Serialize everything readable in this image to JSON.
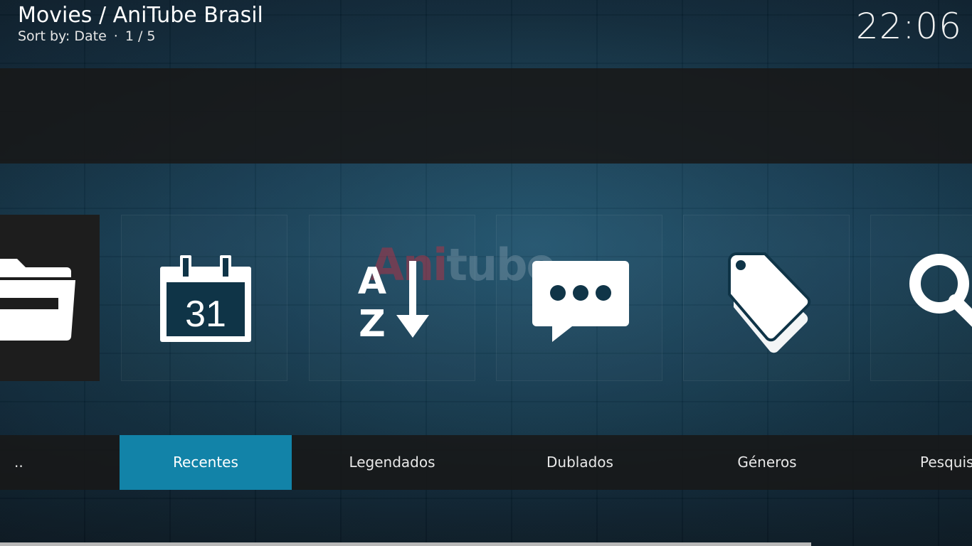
{
  "header": {
    "title": "Movies / AniTube Brasil",
    "sort_label": "Sort by: Date",
    "separator": "·",
    "page_counter": "1 / 5",
    "clock": "22:06"
  },
  "watermark": {
    "brand_part1": "Ani",
    "brand_part2": "tube"
  },
  "items": [
    {
      "label": "..",
      "icon": "folder-back-icon"
    },
    {
      "label": "Recentes",
      "icon": "calendar-icon",
      "calendar_day": "31"
    },
    {
      "label": "Legendados",
      "icon": "sort-az-icon",
      "letter_a": "A",
      "letter_z": "Z"
    },
    {
      "label": "Dublados",
      "icon": "speech-bubble-icon"
    },
    {
      "label": "Géneros",
      "icon": "tags-icon"
    },
    {
      "label": "Pesquis",
      "icon": "search-icon"
    }
  ],
  "colors": {
    "accent": "#1283a8",
    "panel": "#181818",
    "background": "#0c2230"
  }
}
